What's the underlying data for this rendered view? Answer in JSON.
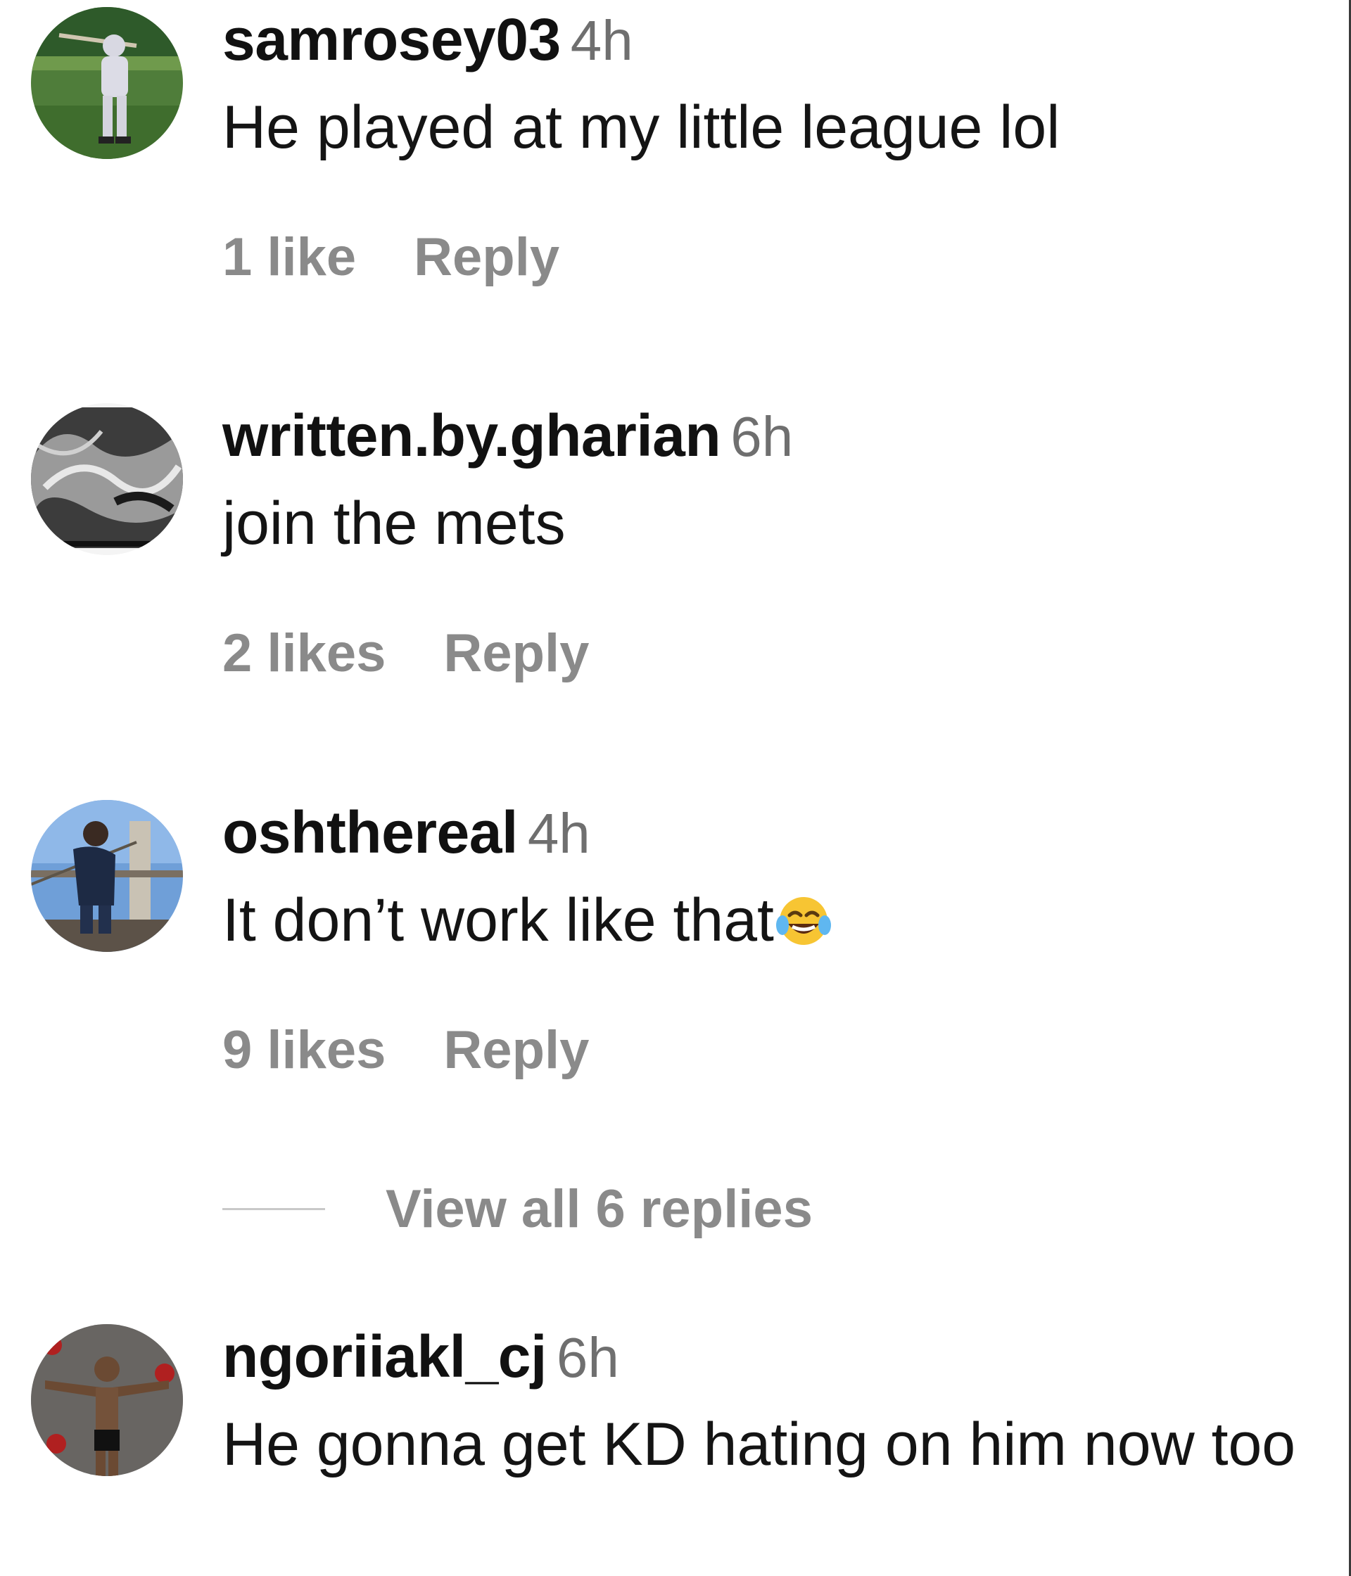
{
  "comments": [
    {
      "username": "samrosey03",
      "time": "4h",
      "text": "He played at my little league lol",
      "likes": "1 like",
      "reply_label": "Reply",
      "avatar_icon": "baseball-player-avatar"
    },
    {
      "username": "written.by.gharian",
      "time": "6h",
      "text": "join the mets",
      "likes": "2 likes",
      "reply_label": "Reply",
      "avatar_icon": "grayscale-abstract-avatar"
    },
    {
      "username": "oshthereal",
      "time": "4h",
      "text": "It don’t work like that",
      "emoji": "face-with-tears-of-joy",
      "likes": "9 likes",
      "reply_label": "Reply",
      "avatar_icon": "bridge-photo-avatar",
      "view_replies_label": "View all 6 replies"
    },
    {
      "username": "ngoriiakl_cj",
      "time": "6h",
      "text": "He gonna get KD hating on him now too",
      "avatar_icon": "fighter-photo-avatar"
    }
  ],
  "colors": {
    "username": "#111111",
    "secondary_text": "#8a8a8a",
    "timestamp": "#6f6f6f",
    "divider": "#c9c9c9"
  }
}
